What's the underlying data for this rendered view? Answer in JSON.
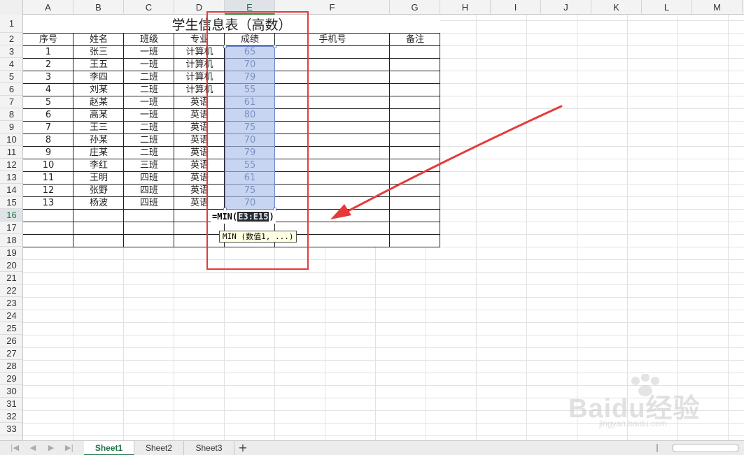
{
  "columns": [
    "A",
    "B",
    "C",
    "D",
    "E",
    "F",
    "G",
    "H",
    "I",
    "J",
    "K",
    "L",
    "M"
  ],
  "active_column": "E",
  "rows": [
    "1",
    "2",
    "3",
    "4",
    "5",
    "6",
    "7",
    "8",
    "9",
    "10",
    "11",
    "12",
    "13",
    "14",
    "15",
    "16",
    "17",
    "18",
    "19",
    "20",
    "21",
    "22",
    "23",
    "24",
    "25",
    "26",
    "27",
    "28",
    "29",
    "30",
    "31",
    "32",
    "33"
  ],
  "active_row": "16",
  "sheet": {
    "title": "学生信息表（高数）",
    "headers": [
      "序号",
      "姓名",
      "班级",
      "专业",
      "成绩",
      "手机号",
      "备注"
    ],
    "data": [
      [
        "1",
        "张三",
        "一班",
        "计算机",
        "65",
        "",
        ""
      ],
      [
        "2",
        "王五",
        "一班",
        "计算机",
        "70",
        "",
        ""
      ],
      [
        "3",
        "李四",
        "二班",
        "计算机",
        "79",
        "",
        ""
      ],
      [
        "4",
        "刘某",
        "二班",
        "计算机",
        "55",
        "",
        ""
      ],
      [
        "5",
        "赵某",
        "一班",
        "英语",
        "61",
        "",
        ""
      ],
      [
        "6",
        "高某",
        "一班",
        "英语",
        "80",
        "",
        ""
      ],
      [
        "7",
        "王三",
        "二班",
        "英语",
        "75",
        "",
        ""
      ],
      [
        "8",
        "孙某",
        "二班",
        "英语",
        "70",
        "",
        ""
      ],
      [
        "9",
        "庄某",
        "二班",
        "英语",
        "79",
        "",
        ""
      ],
      [
        "10",
        "李红",
        "三班",
        "英语",
        "55",
        "",
        ""
      ],
      [
        "11",
        "王明",
        "四班",
        "英语",
        "61",
        "",
        ""
      ],
      [
        "12",
        "张野",
        "四班",
        "英语",
        "75",
        "",
        ""
      ],
      [
        "13",
        "杨波",
        "四班",
        "英语",
        "70",
        "",
        ""
      ]
    ]
  },
  "formula": {
    "prefix": "=MIN(",
    "range": "E3:E15",
    "suffix": ")"
  },
  "tooltip": "MIN (数值1, ...)",
  "sheet_tabs": [
    "Sheet1",
    "Sheet2",
    "Sheet3"
  ],
  "active_tab": "Sheet1",
  "add_sheet_label": "+",
  "watermark": {
    "brand": "Baidu经验",
    "url": "jingyan.baidu.com"
  },
  "colors": {
    "annotation": "#e63a3a",
    "selection": "#aabeeb",
    "active_header_text": "#217346"
  }
}
